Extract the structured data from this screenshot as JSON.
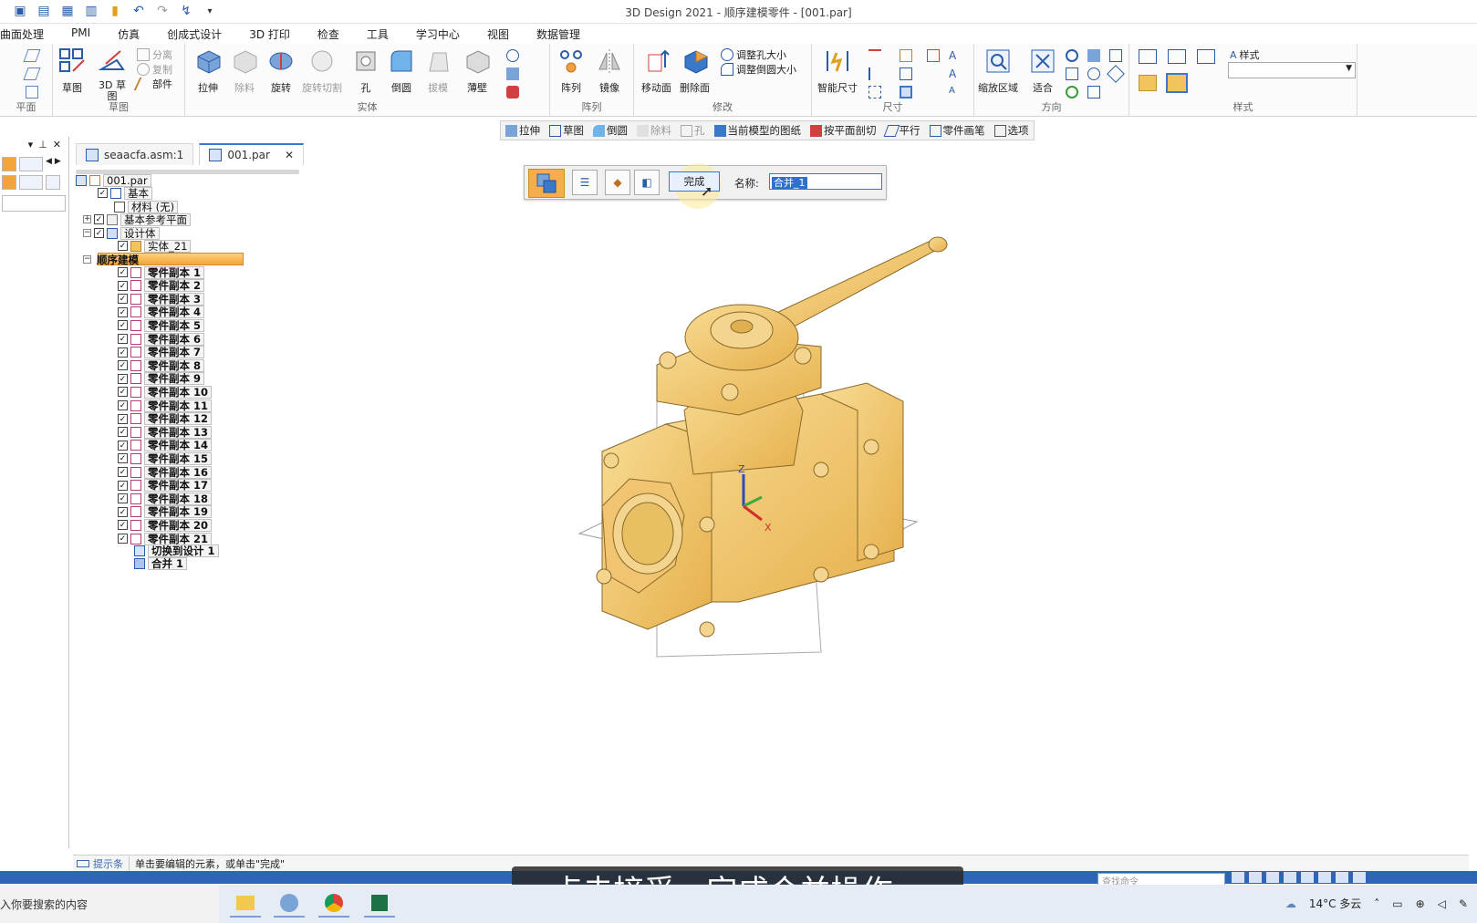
{
  "window": {
    "title": "3D Design 2021 - 顺序建模零件 - [001.par]"
  },
  "menu": {
    "tabs": [
      "曲面处理",
      "PMI",
      "仿真",
      "创成式设计",
      "3D 打印",
      "检查",
      "工具",
      "学习中心",
      "视图",
      "数据管理"
    ]
  },
  "ribbon": {
    "plane": {
      "label": "平面"
    },
    "sketch": {
      "sketch_label": "草图",
      "sketch3d_label": "3D 草图",
      "separate": "分离",
      "copy": "复制",
      "part": "部件",
      "group": "草图"
    },
    "solid": {
      "buttons": [
        "拉伸",
        "除料",
        "旋转",
        "旋转切割",
        "孔",
        "倒圆",
        "拔模",
        "薄壁"
      ],
      "group": "实体"
    },
    "pattern": {
      "pattern": "阵列",
      "mirror": "镜像",
      "group": "阵列"
    },
    "modify": {
      "move_face": "移动面",
      "delete_face": "删除面",
      "resize_hole": "调整孔大小",
      "resize_round": "调整倒圆大小",
      "group": "修改"
    },
    "dimension": {
      "smart": "智能尺寸",
      "group": "尺寸"
    },
    "orient": {
      "zoom_area": "缩放区域",
      "fit": "适合",
      "group": "方向"
    },
    "style": {
      "label": "样式",
      "group": "样式"
    }
  },
  "command_bar": {
    "items": [
      {
        "label": "拉伸",
        "disabled": false
      },
      {
        "label": "草图",
        "disabled": false
      },
      {
        "label": "倒圆",
        "disabled": false
      },
      {
        "label": "除料",
        "disabled": true
      },
      {
        "label": "孔",
        "disabled": true
      },
      {
        "label": "当前模型的图纸",
        "disabled": false
      },
      {
        "label": "按平面剖切",
        "disabled": false
      },
      {
        "label": "平行",
        "disabled": false
      },
      {
        "label": "零件画笔",
        "disabled": false
      },
      {
        "label": "选项",
        "disabled": false
      }
    ]
  },
  "doc_tabs": {
    "tab1": "seaacfa.asm:1",
    "tab2": "001.par"
  },
  "tree": {
    "root": "001.par",
    "base": "基本",
    "material": "材料 (无)",
    "ref_planes": "基本参考平面",
    "design_body": "设计体",
    "solid": "实体_21",
    "sequential": "顺序建模",
    "copies": [
      "零件副本 1",
      "零件副本 2",
      "零件副本 3",
      "零件副本 4",
      "零件副本 5",
      "零件副本 6",
      "零件副本 7",
      "零件副本 8",
      "零件副本 9",
      "零件副本 10",
      "零件副本 11",
      "零件副本 12",
      "零件副本 13",
      "零件副本 14",
      "零件副本 15",
      "零件副本 16",
      "零件副本 17",
      "零件副本 18",
      "零件副本 19",
      "零件副本 20",
      "零件副本 21"
    ],
    "switch_design": "切换到设计 1",
    "union": "合并 1"
  },
  "command_panel": {
    "finish": "完成",
    "name_label": "名称:",
    "name_value": "合并_1"
  },
  "viewport": {
    "axis_z": "Z",
    "axis_x": "X",
    "model_color": "#f2c45e"
  },
  "prompt": {
    "label": "提示条",
    "text": "单击要编辑的元素，或单击\"完成\""
  },
  "status": {
    "find_placeholder": "查找命令"
  },
  "subtitle": "点击接受，完成合并操作。",
  "taskbar": {
    "search": "入你要搜索的内容",
    "weather": "14°C 多云"
  }
}
